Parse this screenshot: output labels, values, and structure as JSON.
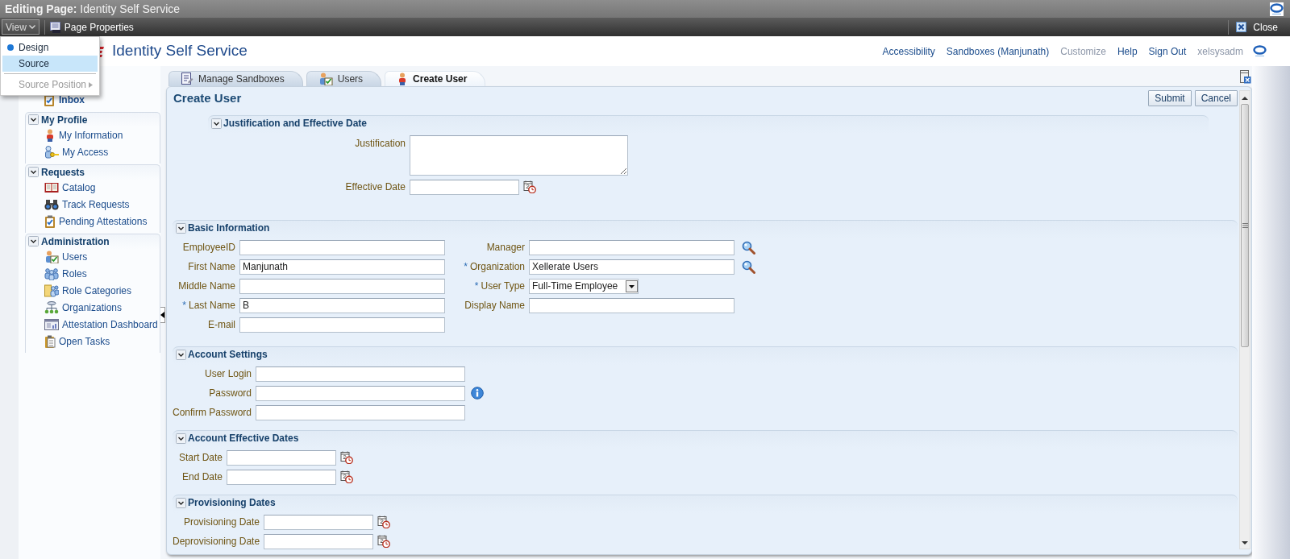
{
  "window": {
    "title": "**Editing Page:** Identity Self Service"
  },
  "toolbar": {
    "view_button": "View",
    "page_properties": "Page Properties",
    "close": "Close"
  },
  "view_menu": [
    {
      "label": "Design",
      "selected": true,
      "highlighted": false,
      "disabled": false,
      "has_submenu": false,
      "separator_before": false
    },
    {
      "label": "Source",
      "selected": false,
      "highlighted": true,
      "disabled": false,
      "has_submenu": false,
      "separator_before": false
    },
    {
      "label": "Source Position",
      "selected": false,
      "highlighted": false,
      "disabled": true,
      "has_submenu": true,
      "separator_before": true
    }
  ],
  "header": {
    "app_title": "Identity Self Service",
    "links": [
      {
        "label": "Accessibility",
        "disabled": false
      },
      {
        "label": "Sandboxes (Manjunath)",
        "disabled": false
      },
      {
        "label": "Customize",
        "disabled": true
      },
      {
        "label": "Help",
        "disabled": false
      },
      {
        "label": "Sign Out",
        "disabled": false
      }
    ],
    "user": "xelsysadm"
  },
  "sidebar": {
    "inbox": "Inbox",
    "groups": [
      {
        "title": "My Profile",
        "expanded": true,
        "items": [
          "My Information",
          "My Access"
        ]
      },
      {
        "title": "Requests",
        "expanded": true,
        "items": [
          "Catalog",
          "Track Requests",
          "Pending Attestations"
        ]
      },
      {
        "title": "Administration",
        "expanded": true,
        "items": [
          "Users",
          "Roles",
          "Role Categories",
          "Organizations",
          "Attestation Dashboard",
          "Open Tasks"
        ]
      }
    ]
  },
  "tabs": [
    {
      "label": "Manage Sandboxes",
      "selected": false
    },
    {
      "label": "Users",
      "selected": false
    },
    {
      "label": "Create User",
      "selected": true
    }
  ],
  "page": {
    "title": "Create User",
    "buttons": [
      "Submit",
      "Cancel"
    ]
  },
  "sections": [
    {
      "title": "Justification and Effective Date",
      "expanded": true,
      "columns": [
        [
          {
            "label": "Justification",
            "kind": "textarea"
          },
          {
            "label": "Effective Date",
            "kind": "date"
          }
        ]
      ]
    },
    {
      "title": "Basic Information",
      "expanded": true,
      "columns": [
        [
          {
            "label": "EmployeeID",
            "kind": "text"
          },
          {
            "label": "First Name",
            "kind": "text",
            "value": "Manjunath"
          },
          {
            "label": "Middle Name",
            "kind": "text"
          },
          {
            "label": "Last Name",
            "kind": "text",
            "required_mark": "*",
            "value": "B"
          },
          {
            "label": "E-mail",
            "kind": "text"
          }
        ],
        [
          {
            "label": "Manager",
            "kind": "lookup"
          },
          {
            "label": "Organization",
            "kind": "lookup",
            "required_mark": "*",
            "value": "Xellerate Users"
          },
          {
            "label": "User Type",
            "kind": "select",
            "required_mark": "*",
            "value": "Full-Time Employee"
          },
          {
            "label": "Display Name",
            "kind": "text"
          }
        ]
      ]
    },
    {
      "title": "Account Settings",
      "expanded": true,
      "columns": [
        [
          {
            "label": "User Login",
            "kind": "text"
          },
          {
            "label": "Password",
            "kind": "password",
            "help": true
          },
          {
            "label": "Confirm Password",
            "kind": "password"
          }
        ]
      ]
    },
    {
      "title": "Account Effective Dates",
      "expanded": true,
      "columns": [
        [
          {
            "label": "Start Date",
            "kind": "date"
          },
          {
            "label": "End Date",
            "kind": "date"
          }
        ]
      ]
    },
    {
      "title": "Provisioning Dates",
      "expanded": true,
      "columns": [
        [
          {
            "label": "Provisioning Date",
            "kind": "date"
          },
          {
            "label": "Deprovisioning Date",
            "kind": "date"
          }
        ]
      ]
    }
  ]
}
